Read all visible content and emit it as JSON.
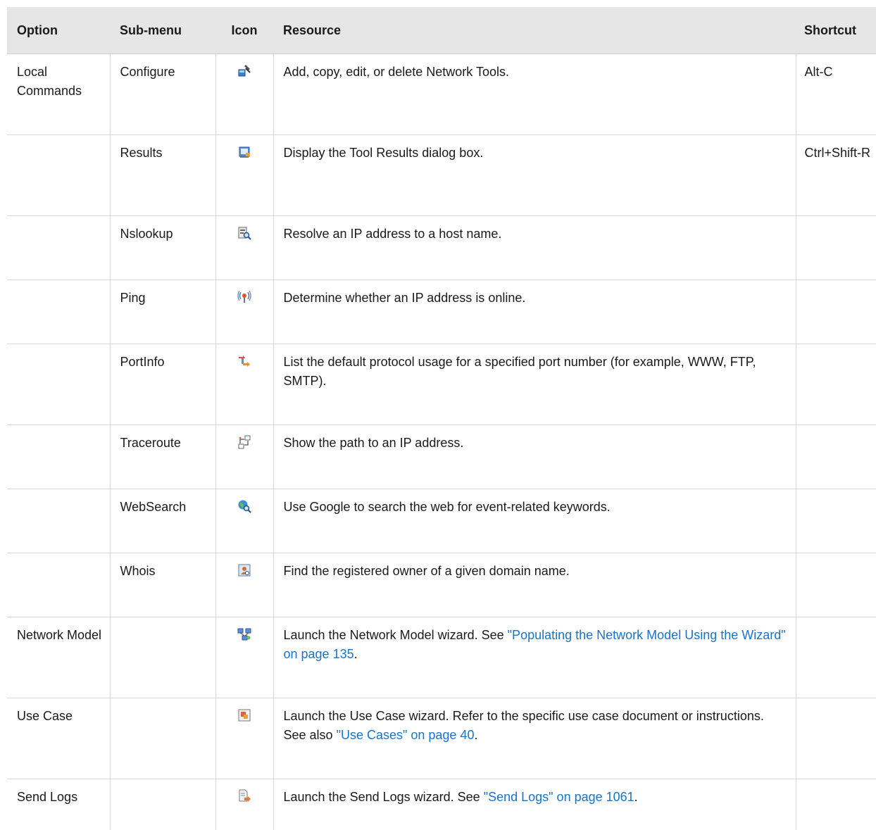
{
  "headers": {
    "option": "Option",
    "submenu": "Sub-menu",
    "icon": "Icon",
    "resource": "Resource",
    "shortcut": "Shortcut"
  },
  "rows": [
    {
      "option": "Local Commands",
      "submenu": "Configure",
      "icon": "configure-icon",
      "resource_text": "Add, copy, edit, or delete Network Tools.",
      "resource_link": "",
      "resource_after": "",
      "shortcut": "Alt-C"
    },
    {
      "option": "",
      "submenu": "Results",
      "icon": "results-icon",
      "resource_text": "Display the Tool Results dialog box.",
      "resource_link": "",
      "resource_after": "",
      "shortcut": "Ctrl+Shift-R"
    },
    {
      "option": "",
      "submenu": "Nslookup",
      "icon": "nslookup-icon",
      "resource_text": "Resolve an IP address to a host name.",
      "resource_link": "",
      "resource_after": "",
      "shortcut": ""
    },
    {
      "option": "",
      "submenu": "Ping",
      "icon": "ping-icon",
      "resource_text": "Determine whether an IP address is online.",
      "resource_link": "",
      "resource_after": "",
      "shortcut": ""
    },
    {
      "option": "",
      "submenu": "PortInfo",
      "icon": "portinfo-icon",
      "resource_text": "List the default protocol usage for a specified port number (for example, WWW, FTP, SMTP).",
      "resource_link": "",
      "resource_after": "",
      "shortcut": ""
    },
    {
      "option": "",
      "submenu": "Traceroute",
      "icon": "traceroute-icon",
      "resource_text": "Show the path to an IP address.",
      "resource_link": "",
      "resource_after": "",
      "shortcut": ""
    },
    {
      "option": "",
      "submenu": "WebSearch",
      "icon": "websearch-icon",
      "resource_text": "Use Google to search the web for event-related keywords.",
      "resource_link": "",
      "resource_after": "",
      "shortcut": ""
    },
    {
      "option": "",
      "submenu": "Whois",
      "icon": "whois-icon",
      "resource_text": "Find the registered owner of a given domain name.",
      "resource_link": "",
      "resource_after": "",
      "shortcut": ""
    },
    {
      "option": "Network Model",
      "submenu": "",
      "icon": "network-model-icon",
      "resource_text": "Launch the Network Model wizard. See ",
      "resource_link": "\"Populating the Network Model Using the Wizard\" on page 135",
      "resource_after": ".",
      "shortcut": ""
    },
    {
      "option": "Use Case",
      "submenu": "",
      "icon": "use-case-icon",
      "resource_text": "Launch the Use Case wizard. Refer to the specific use case document or instructions. See also ",
      "resource_link": "\"Use Cases\" on page 40",
      "resource_after": ".",
      "shortcut": ""
    },
    {
      "option": "Send Logs",
      "submenu": "",
      "icon": "send-logs-icon",
      "resource_text": "Launch the Send Logs wizard. See ",
      "resource_link": "\"Send Logs\" on page 1061",
      "resource_after": ".",
      "shortcut": ""
    }
  ]
}
